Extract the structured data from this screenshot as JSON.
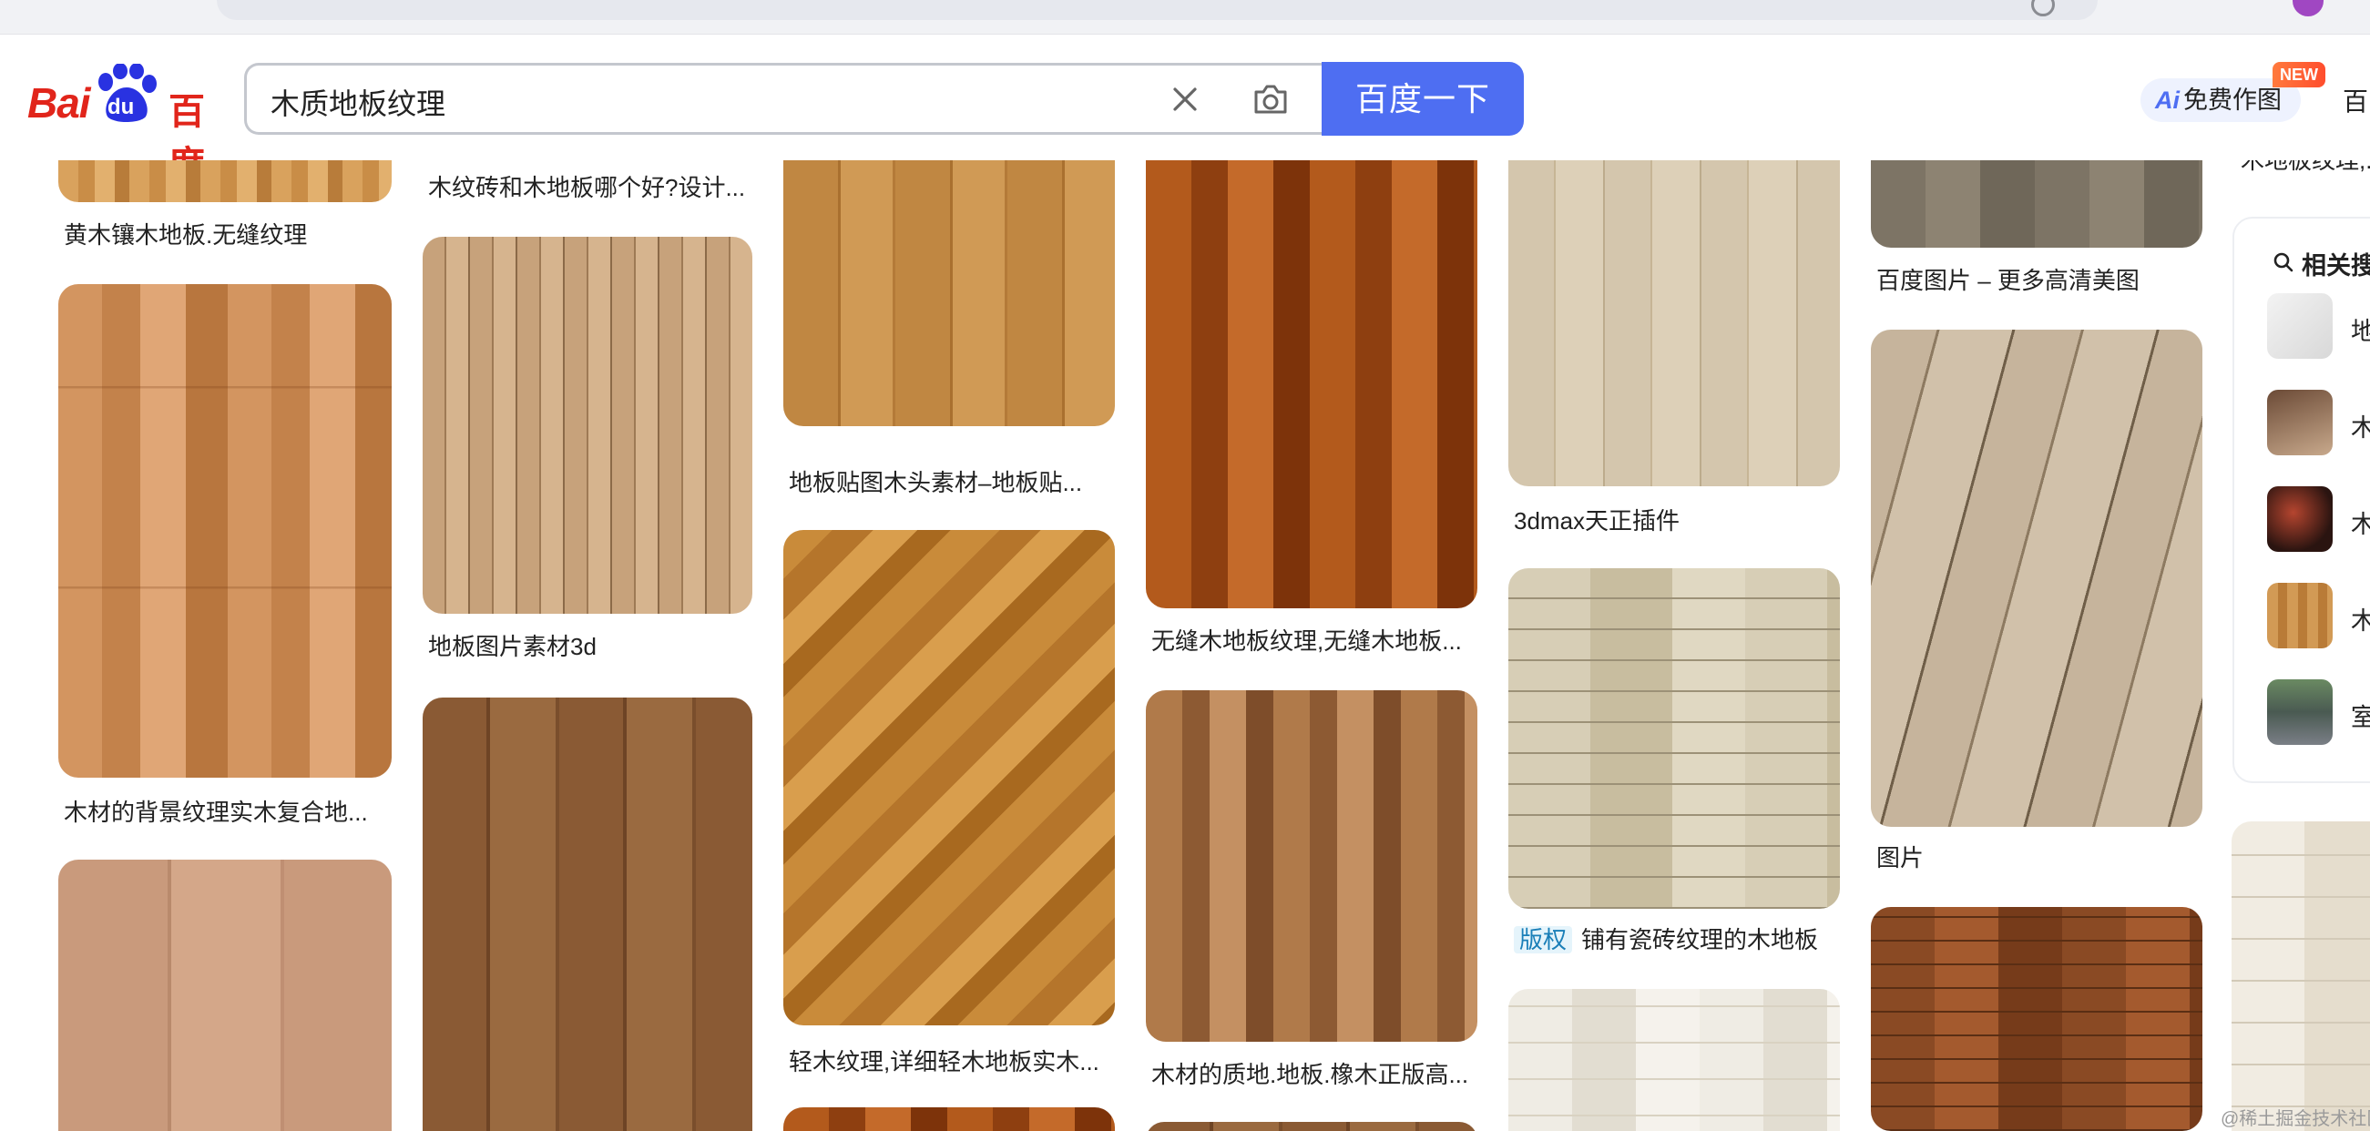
{
  "search": {
    "query": "木质地板纹理",
    "button_label": "百度一下"
  },
  "header": {
    "logo_latin": "Bai",
    "logo_du": "du",
    "logo_cn": "百度",
    "ai_label": "免费作图",
    "ai_icon": "Ai",
    "new_badge": "NEW",
    "cut_link": "百"
  },
  "grid": {
    "col1": [
      {
        "caption": "黄木镶木地板.无缝纹理"
      },
      {
        "caption": "木材的背景纹理实木复合地..."
      },
      {
        "caption": ""
      }
    ],
    "col2": [
      {
        "caption": "木纹砖和木地板哪个好?设计..."
      },
      {
        "caption": "地板图片素材3d"
      },
      {
        "caption": ""
      }
    ],
    "col3": [
      {
        "caption": "地板贴图木头素材–地板贴..."
      },
      {
        "caption": "轻木纹理,详细轻木地板实木..."
      },
      {
        "caption": ""
      }
    ],
    "col4": [
      {
        "caption": "无缝木地板纹理,无缝木地板..."
      },
      {
        "caption": "木材的质地.地板.橡木正版高..."
      },
      {
        "caption": ""
      }
    ],
    "col5": [
      {
        "caption": "3dmax天正插件"
      },
      {
        "caption": "铺有瓷砖纹理的木地板",
        "copyright": "版权"
      },
      {
        "caption": ""
      }
    ],
    "col6": [
      {
        "caption": "百度图片 – 更多高清美图"
      },
      {
        "caption": "图片"
      },
      {
        "caption": ""
      }
    ],
    "col7_top_caption": "木地板纹理,..."
  },
  "related": {
    "title": "相关搜",
    "items": [
      {
        "label": "地"
      },
      {
        "label": "木"
      },
      {
        "label": "木"
      },
      {
        "label": "木"
      },
      {
        "label": "室"
      }
    ]
  },
  "watermark": "@稀土掘金技术社区"
}
